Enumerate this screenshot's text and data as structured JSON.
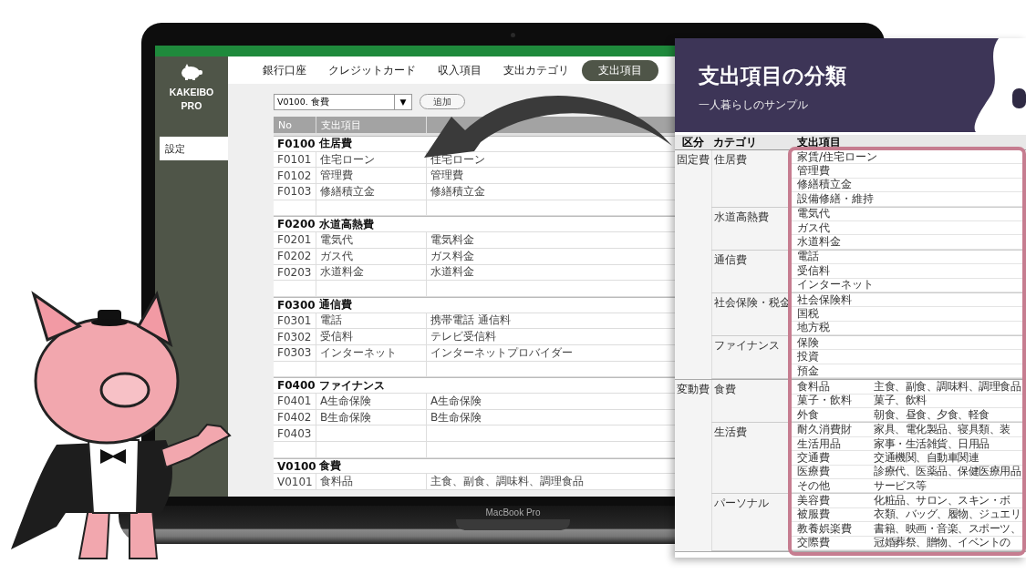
{
  "laptop": {
    "label": "MacBook Pro"
  },
  "app": {
    "brand": "KAKEIBO PRO",
    "sidebar": [
      {
        "label": "設定",
        "selected": true
      }
    ],
    "tabs": [
      {
        "label": "銀行口座",
        "selected": false
      },
      {
        "label": "クレジットカード",
        "selected": false
      },
      {
        "label": "収入項目",
        "selected": false
      },
      {
        "label": "支出カテゴリ",
        "selected": false
      },
      {
        "label": "支出項目",
        "selected": true
      }
    ],
    "toolbar": {
      "dropdown": "V0100. 食費",
      "dropdown_arrow": "▼",
      "button": "追加"
    },
    "table": {
      "columns": [
        "No",
        "支出項目"
      ],
      "rows": [
        {
          "kind": "group",
          "no": "F0100",
          "name": "住居費"
        },
        {
          "kind": "item",
          "no": "F0101",
          "name": "住宅ローン",
          "note": "住宅ローン"
        },
        {
          "kind": "item",
          "no": "F0102",
          "name": "管理費",
          "note": "管理費"
        },
        {
          "kind": "item",
          "no": "F0103",
          "name": "修繕積立金",
          "note": "修繕積立金"
        },
        {
          "kind": "blank"
        },
        {
          "kind": "group",
          "no": "F0200",
          "name": "水道高熱費"
        },
        {
          "kind": "item",
          "no": "F0201",
          "name": "電気代",
          "note": "電気料金"
        },
        {
          "kind": "item",
          "no": "F0202",
          "name": "ガス代",
          "note": "ガス料金"
        },
        {
          "kind": "item",
          "no": "F0203",
          "name": "水道料金",
          "note": "水道料金"
        },
        {
          "kind": "blank"
        },
        {
          "kind": "group",
          "no": "F0300",
          "name": "通信費"
        },
        {
          "kind": "item",
          "no": "F0301",
          "name": "電話",
          "note": "携帯電話 通信料"
        },
        {
          "kind": "item",
          "no": "F0302",
          "name": "受信料",
          "note": "テレビ受信料"
        },
        {
          "kind": "item",
          "no": "F0303",
          "name": "インターネット",
          "note": "インターネットプロバイダー"
        },
        {
          "kind": "blank"
        },
        {
          "kind": "group",
          "no": "F0400",
          "name": "ファイナンス"
        },
        {
          "kind": "item",
          "no": "F0401",
          "name": "A生命保険",
          "note": "A生命保険"
        },
        {
          "kind": "item",
          "no": "F0402",
          "name": "B生命保険",
          "note": "B生命保険"
        },
        {
          "kind": "item",
          "no": "F0403"
        },
        {
          "kind": "blank"
        },
        {
          "kind": "group",
          "no": "V0100",
          "name": "食費"
        },
        {
          "kind": "item",
          "no": "V0101",
          "name": "食料品",
          "note": "主食、副食、調味料、調理食品"
        }
      ]
    }
  },
  "document": {
    "title": "支出項目の分類",
    "subtitle": "一人暮らしのサンプル",
    "columns": [
      "区分",
      "カテゴリ",
      "支出項目"
    ],
    "sections": [
      {
        "name": "固定費",
        "categories": [
          {
            "name": "住居費",
            "items": [
              {
                "name": "家賃/住宅ローン"
              },
              {
                "name": "管理費"
              },
              {
                "name": "修繕積立金"
              },
              {
                "name": "設備修繕・維持"
              }
            ]
          },
          {
            "name": "水道高熱費",
            "items": [
              {
                "name": "電気代"
              },
              {
                "name": "ガス代"
              },
              {
                "name": "水道料金"
              }
            ]
          },
          {
            "name": "通信費",
            "items": [
              {
                "name": "電話"
              },
              {
                "name": "受信料"
              },
              {
                "name": "インターネット"
              }
            ]
          },
          {
            "name": "社会保険・税金",
            "items": [
              {
                "name": "社会保険料"
              },
              {
                "name": "国税"
              },
              {
                "name": "地方税"
              }
            ]
          },
          {
            "name": "ファイナンス",
            "items": [
              {
                "name": "保険"
              },
              {
                "name": "投資"
              },
              {
                "name": "預金"
              }
            ]
          }
        ]
      },
      {
        "name": "変動費",
        "categories": [
          {
            "name": "食費",
            "items": [
              {
                "name": "食料品",
                "detail": "主食、副食、調味料、調理食品"
              },
              {
                "name": "菓子・飲料",
                "detail": "菓子、飲料"
              },
              {
                "name": "外食",
                "detail": "朝食、昼食、夕食、軽食"
              }
            ]
          },
          {
            "name": "生活費",
            "items": [
              {
                "name": "耐久消費財",
                "detail": "家具、電化製品、寝具類、装"
              },
              {
                "name": "生活用品",
                "detail": "家事・生活雑貨、日用品"
              },
              {
                "name": "交通費",
                "detail": "交通機関、自動車関連"
              },
              {
                "name": "医療費",
                "detail": "診療代、医薬品、保健医療用品"
              },
              {
                "name": "その他",
                "detail": "サービス等"
              }
            ]
          },
          {
            "name": "パーソナル",
            "items": [
              {
                "name": "美容費",
                "detail": "化粧品、サロン、スキン・ボ"
              },
              {
                "name": "被服費",
                "detail": "衣類、バッグ、履物、ジュエリ"
              },
              {
                "name": "教養娯楽費",
                "detail": "書籍、映画・音楽、スポーツ、"
              },
              {
                "name": "交際費",
                "detail": "冠婚葬祭、贈物、イベントの"
              }
            ]
          }
        ]
      }
    ]
  }
}
